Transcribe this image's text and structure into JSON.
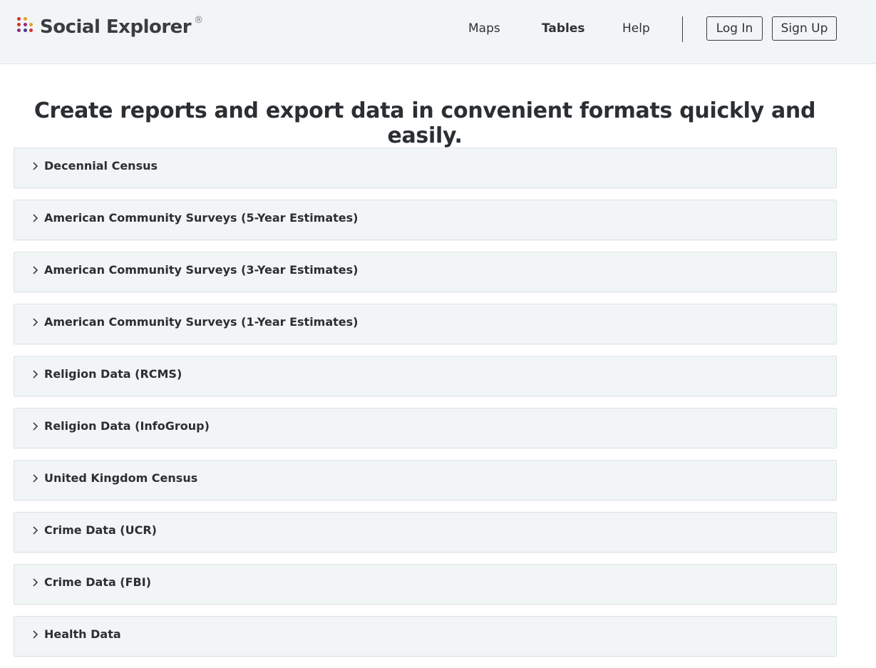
{
  "brand": {
    "name": "Social Explorer",
    "registered_mark": "®",
    "dot_colors": [
      "#d0342c",
      "#e8a02a",
      "#8a2c7a",
      "#3b3f8c"
    ]
  },
  "nav": {
    "items": [
      {
        "label": "Maps",
        "active": false
      },
      {
        "label": "Tables",
        "active": true
      },
      {
        "label": "Help",
        "active": false
      }
    ],
    "login_label": "Log In",
    "signup_label": "Sign Up"
  },
  "main": {
    "headline": "Create reports and export data in convenient formats quickly and easily.",
    "datasets": [
      {
        "label": "Decennial Census"
      },
      {
        "label": "American Community Surveys (5-Year Estimates)"
      },
      {
        "label": "American Community Surveys (3-Year Estimates)"
      },
      {
        "label": "American Community Surveys (1-Year Estimates)"
      },
      {
        "label": "Religion Data (RCMS)"
      },
      {
        "label": "Religion Data (InfoGroup)"
      },
      {
        "label": "United Kingdom Census"
      },
      {
        "label": "Crime Data (UCR)"
      },
      {
        "label": "Crime Data (FBI)"
      },
      {
        "label": "Health Data"
      }
    ],
    "chevron_icon": "chevron-right-icon"
  },
  "colors": {
    "header_bg": "#f2f5f6",
    "panel_bg": "#f2f5f6",
    "text": "#2b2f33"
  }
}
